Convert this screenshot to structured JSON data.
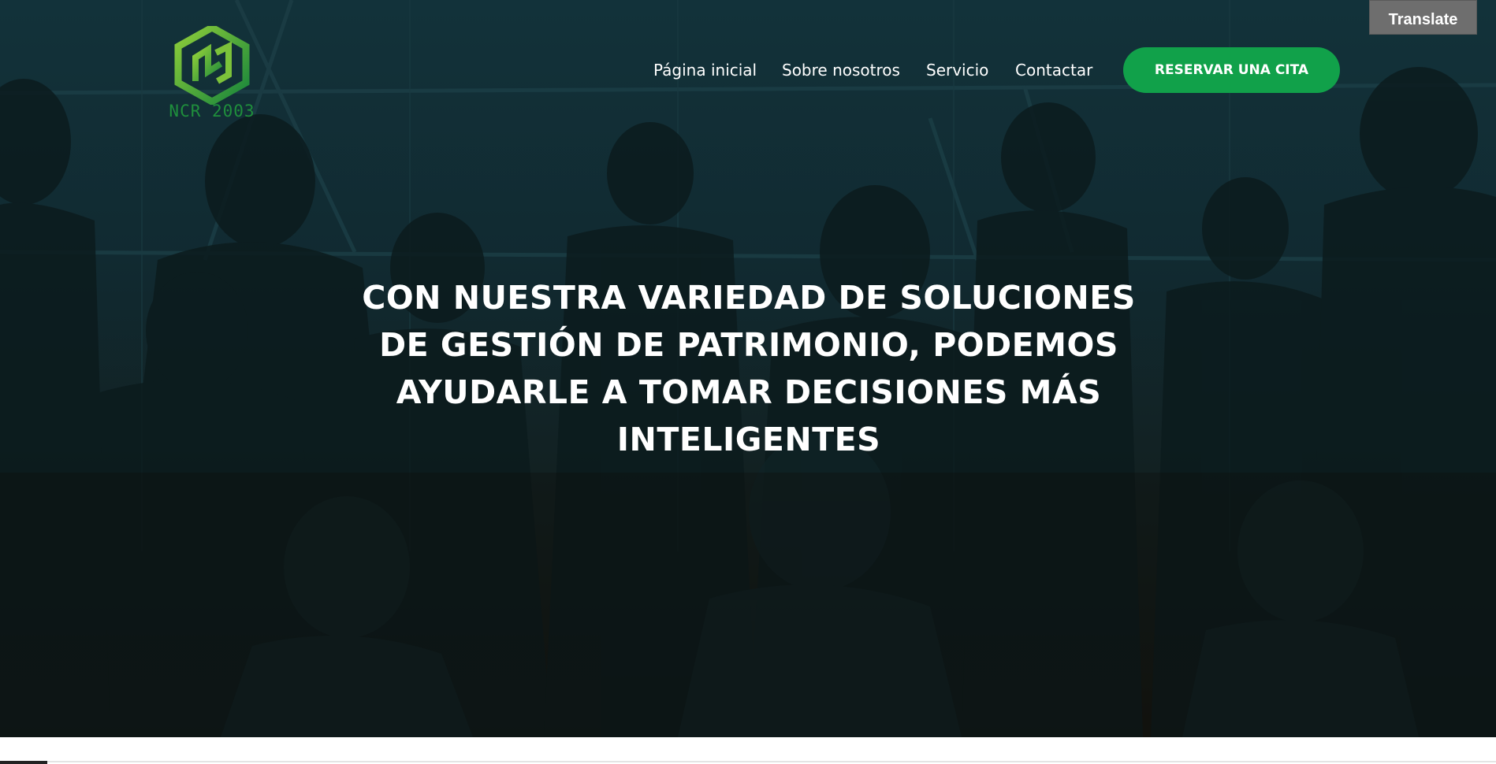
{
  "translate": {
    "label": "Translate"
  },
  "logo": {
    "text": "NCR 2003"
  },
  "nav": {
    "items": [
      {
        "label": "Página inicial"
      },
      {
        "label": "Sobre nosotros"
      },
      {
        "label": "Servicio"
      },
      {
        "label": "Contactar"
      }
    ],
    "cta_label": "RESERVAR UNA CITA"
  },
  "hero": {
    "headline_lines": [
      "CON NUESTRA VARIEDAD DE SOLUCIONES",
      "DE GESTIÓN DE PATRIMONIO, PODEMOS",
      "AYUDARLE A TOMAR DECISIONES MÁS",
      "INTELIGENTES"
    ]
  },
  "colors": {
    "accent": "#11a14a",
    "logo_green": "#1f8f3c",
    "overlay_top": "#12323a",
    "overlay_bottom": "#13140f"
  }
}
